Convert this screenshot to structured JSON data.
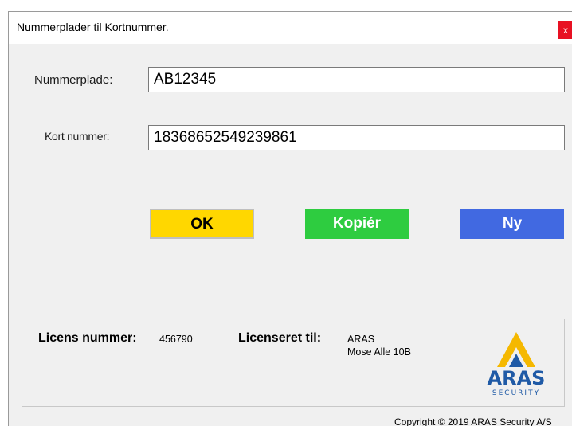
{
  "window": {
    "title": "Nummerplader til Kortnummer.",
    "close_label": "x"
  },
  "form": {
    "plate_label": "Nummerplade:",
    "plate_value": "AB12345",
    "card_label": "Kort nummer:",
    "card_value": "18368652549239861"
  },
  "buttons": {
    "ok_label": "OK",
    "copy_label": "Kopiér",
    "new_label": "Ny"
  },
  "license": {
    "number_label": "Licens nummer:",
    "number_value": "456790",
    "licensed_to_label": "Licenseret til:",
    "licensee_name": "ARAS",
    "licensee_address": "Mose Alle 10B"
  },
  "logo": {
    "name": "ARAS",
    "tagline": "SECURITY"
  },
  "footer": {
    "copyright": "Copyright © 2019 ARAS Security A/S"
  },
  "colors": {
    "ok_button": "#ffd700",
    "copy_button": "#2ecc40",
    "new_button": "#4169e1",
    "close_button": "#e81123",
    "logo_yellow": "#f5b800",
    "logo_blue": "#1f5aa6"
  }
}
